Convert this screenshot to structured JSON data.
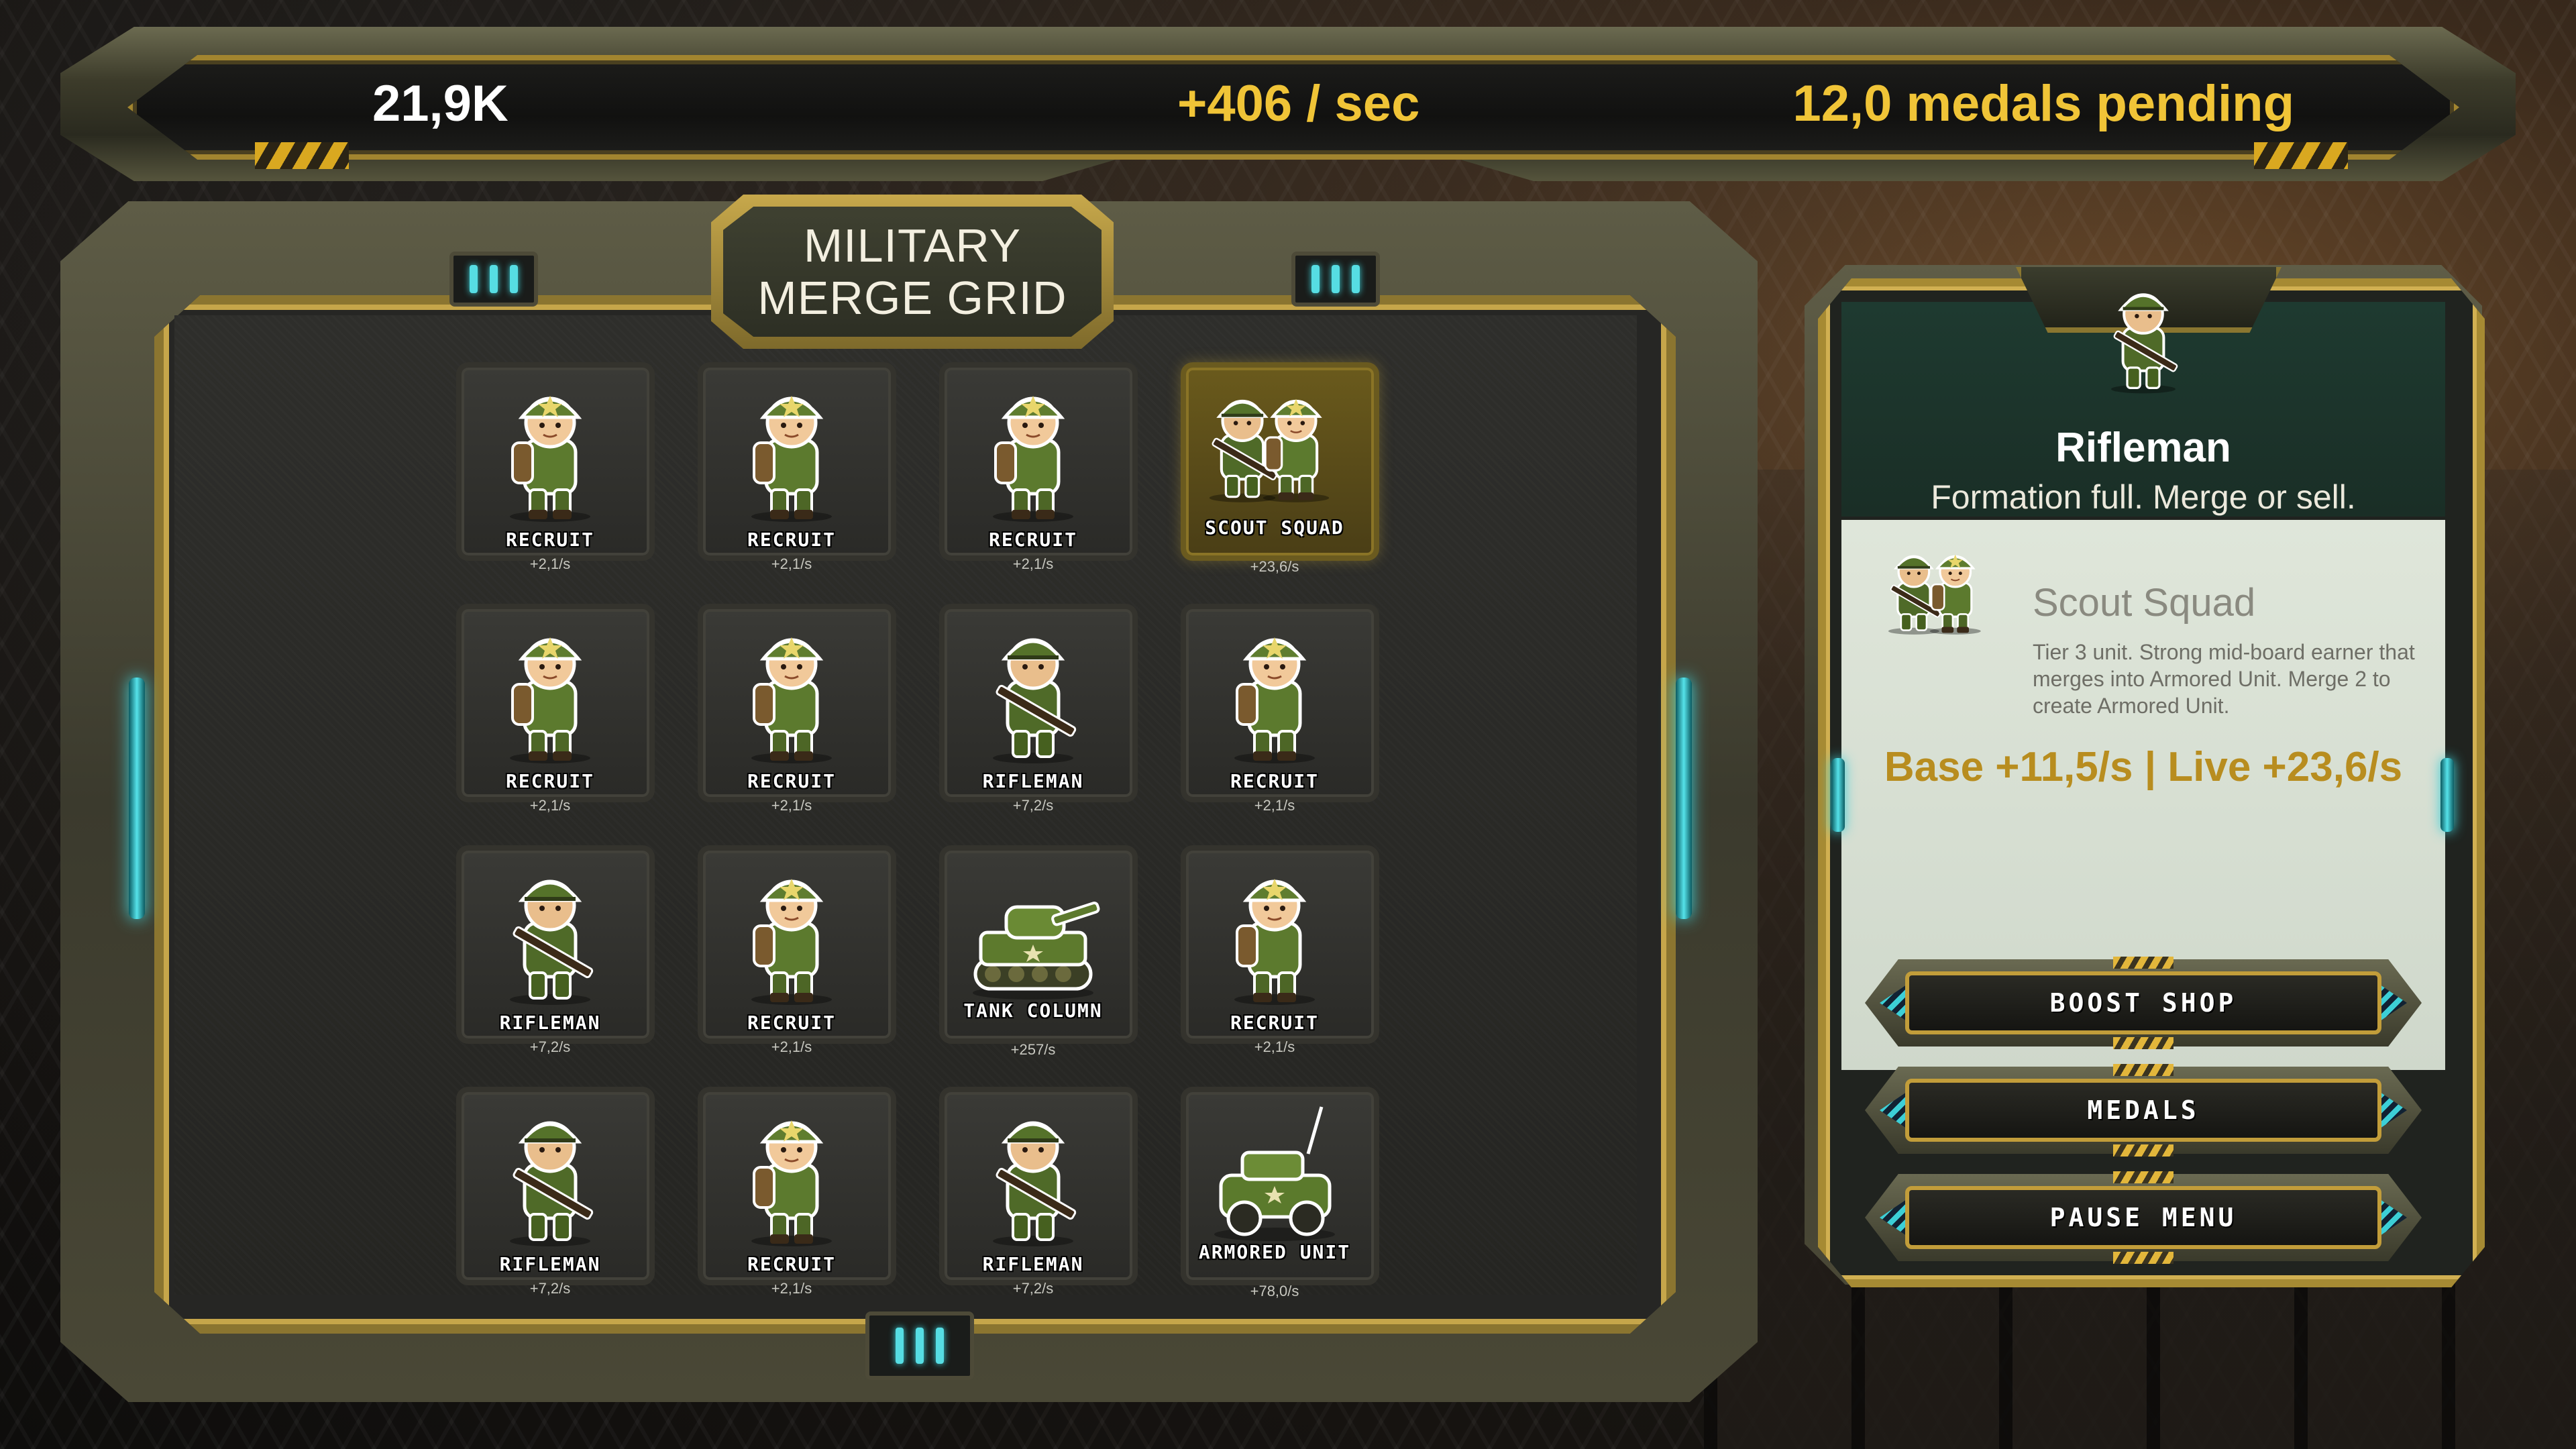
{
  "hud": {
    "money": "21,9K",
    "rate": "+406 / sec",
    "medals_pending": "12,0 medals pending"
  },
  "grid": {
    "title_line1": "MILITARY",
    "title_line2": "MERGE GRID",
    "cells": [
      {
        "unit": "RECRUIT",
        "rate": "+2,1/s",
        "sprite": "soldier-icon"
      },
      {
        "unit": "RECRUIT",
        "rate": "+2,1/s",
        "sprite": "soldier-icon"
      },
      {
        "unit": "RECRUIT",
        "rate": "+2,1/s",
        "sprite": "soldier-icon"
      },
      {
        "unit": "SCOUT SQUAD",
        "rate": "+23,6/s",
        "sprite": "squad-icon",
        "selected": true
      },
      {
        "unit": "RECRUIT",
        "rate": "+2,1/s",
        "sprite": "soldier-icon"
      },
      {
        "unit": "RECRUIT",
        "rate": "+2,1/s",
        "sprite": "soldier-icon"
      },
      {
        "unit": "RIFLEMAN",
        "rate": "+7,2/s",
        "sprite": "rifleman-icon"
      },
      {
        "unit": "RECRUIT",
        "rate": "+2,1/s",
        "sprite": "soldier-icon"
      },
      {
        "unit": "RIFLEMAN",
        "rate": "+7,2/s",
        "sprite": "rifleman-icon"
      },
      {
        "unit": "RECRUIT",
        "rate": "+2,1/s",
        "sprite": "soldier-icon"
      },
      {
        "unit": "TANK COLUMN",
        "rate": "+257/s",
        "sprite": "tank-icon"
      },
      {
        "unit": "RECRUIT",
        "rate": "+2,1/s",
        "sprite": "soldier-icon"
      },
      {
        "unit": "RIFLEMAN",
        "rate": "+7,2/s",
        "sprite": "rifleman-icon"
      },
      {
        "unit": "RECRUIT",
        "rate": "+2,1/s",
        "sprite": "soldier-icon"
      },
      {
        "unit": "RIFLEMAN",
        "rate": "+7,2/s",
        "sprite": "rifleman-icon"
      },
      {
        "unit": "ARMORED UNIT",
        "rate": "+78,0/s",
        "sprite": "jeep-icon"
      }
    ]
  },
  "info_panel": {
    "unit_name": "Rifleman",
    "status": "Formation full. Merge or sell.",
    "card_title": "Scout Squad",
    "card_desc": "Tier 3 unit. Strong mid-board earner that merges into Armored Unit. Merge 2 to create Armored Unit.",
    "income": "Base +11,5/s | Live +23,6/s"
  },
  "buttons": {
    "boost_shop": "BOOST SHOP",
    "medals": "MEDALS",
    "pause_menu": "PAUSE MENU"
  },
  "colors": {
    "accent_gold": "#f0c437",
    "frame_gold": "#a68a33",
    "cyan_light": "#55e3ea",
    "olive": "#5b6b2b"
  }
}
